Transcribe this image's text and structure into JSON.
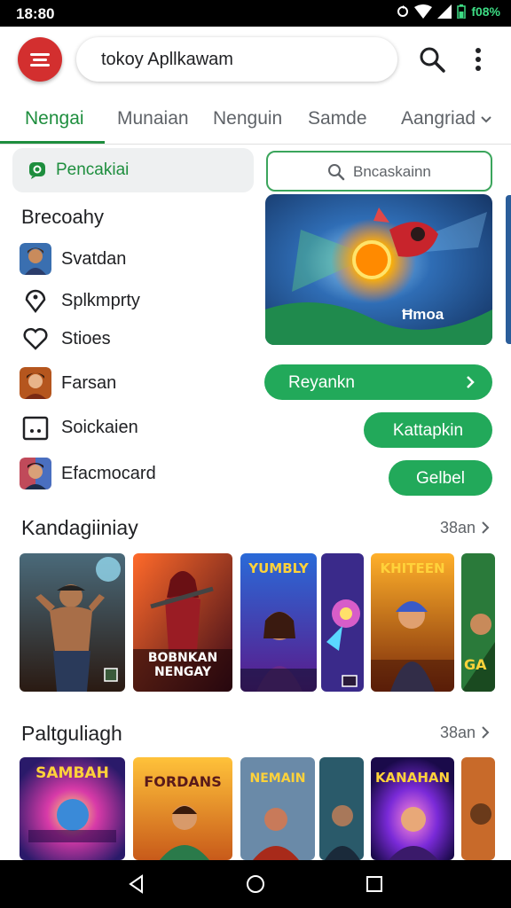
{
  "status": {
    "time": "18:80",
    "battery_text": "f08%"
  },
  "search": {
    "value": "tokoy Apllkawam"
  },
  "tabs": [
    {
      "label": "Nengai"
    },
    {
      "label": "Munaian"
    },
    {
      "label": "Nenguin"
    },
    {
      "label": "Samde"
    },
    {
      "label": "Aangriad"
    }
  ],
  "chip": {
    "label": "Pencakiai"
  },
  "left_section": {
    "title": "Brecoahy",
    "items": [
      {
        "label": "Svatdan",
        "icon": "avatar-icon"
      },
      {
        "label": "Splkmprty",
        "icon": "pin-heart-icon"
      },
      {
        "label": "Stioes",
        "icon": "heart-icon"
      },
      {
        "label": "Farsan",
        "icon": "avatar-icon"
      },
      {
        "label": "Soickaien",
        "icon": "dice-icon"
      },
      {
        "label": "Efacmocard",
        "icon": "avatar-icon"
      }
    ]
  },
  "right_panel": {
    "search_placeholder": "Bncaskainn",
    "hero_caption": "Ħmoa",
    "buttons": [
      {
        "label": "Reyankn"
      },
      {
        "label": "Kattapkin"
      },
      {
        "label": "Gelbel"
      }
    ]
  },
  "sections": [
    {
      "title": "Kandagiiniay",
      "more": "38an",
      "cards": [
        {
          "text": ""
        },
        {
          "text": "BOBNKAN NENGAY"
        },
        {
          "text": "YUMBLY"
        },
        {
          "text": ""
        },
        {
          "text": "KHITEEN"
        },
        {
          "text": "GA"
        }
      ]
    },
    {
      "title": "Paltguliagh",
      "more": "38an",
      "cards": [
        {
          "text": "SAMBAH"
        },
        {
          "text": "FORDANS"
        },
        {
          "text": "NEMAIN"
        },
        {
          "text": ""
        },
        {
          "text": "KANAHAN"
        },
        {
          "text": ""
        }
      ]
    }
  ],
  "colors": {
    "accent": "#1e8e3e",
    "button": "#22a95a",
    "menu": "#d32f2f"
  }
}
